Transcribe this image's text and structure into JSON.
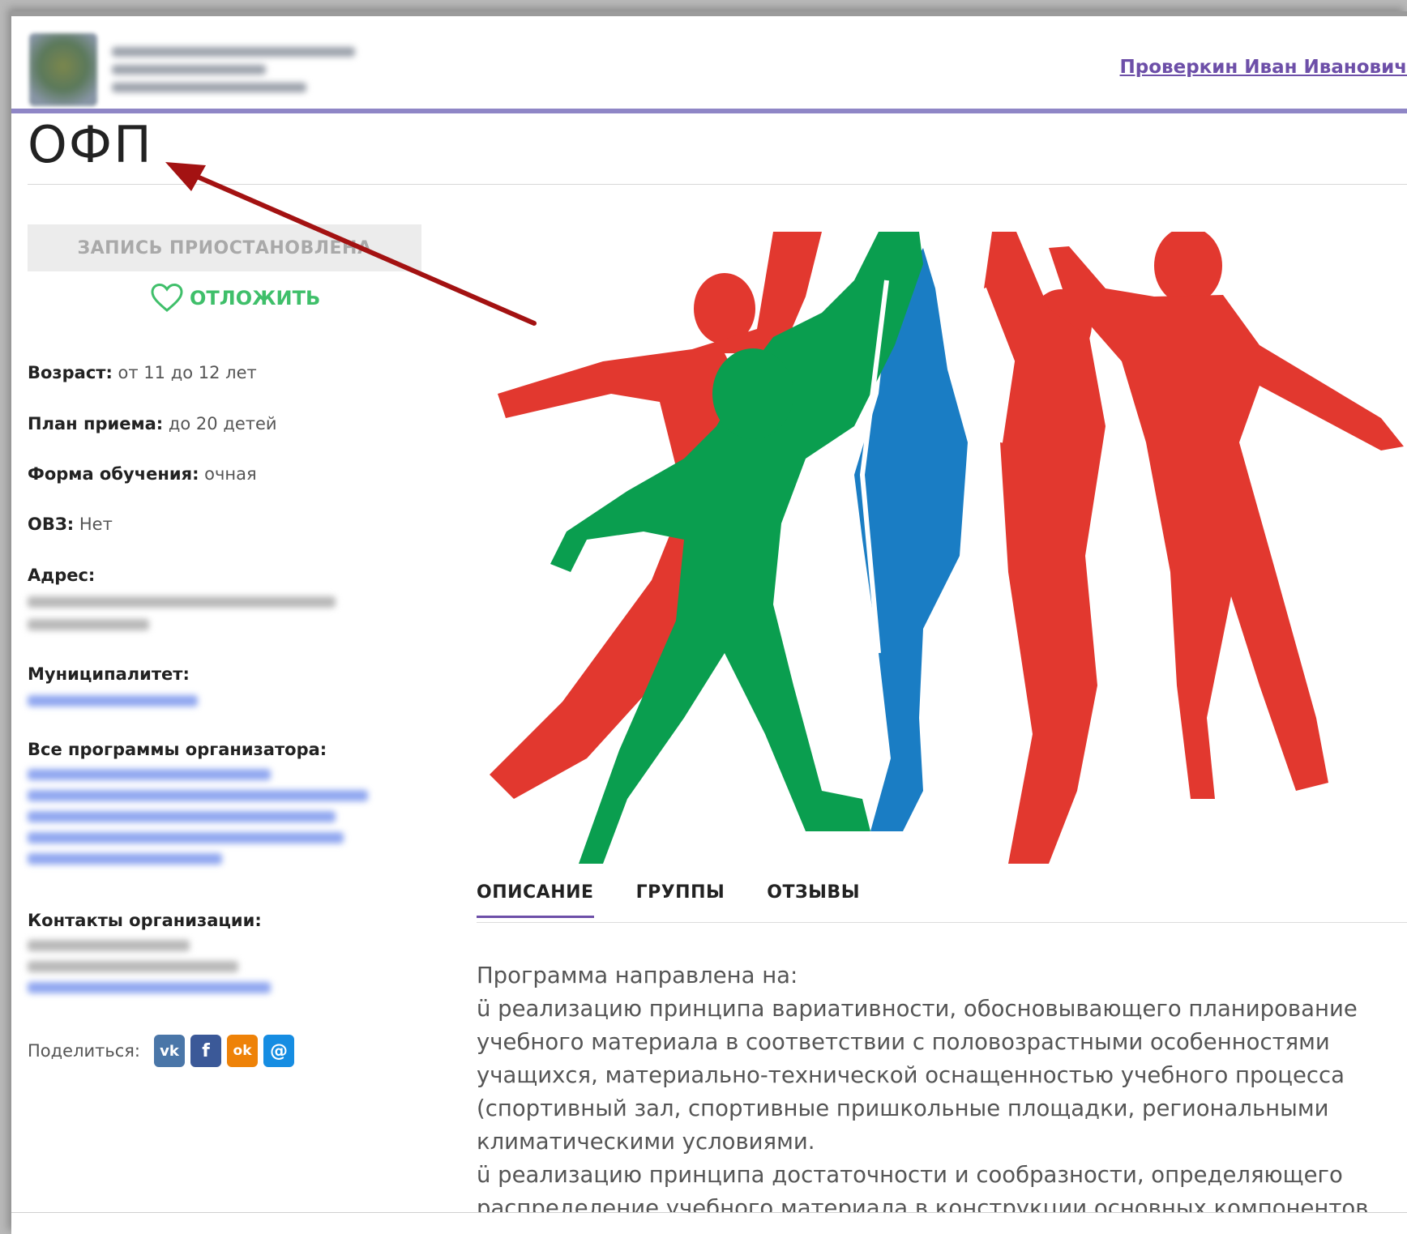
{
  "header": {
    "user_name": "Проверкин Иван Иванович"
  },
  "program": {
    "title": "ОФП",
    "status_button": "ЗАПИСЬ ПРИОСТАНОВЛЕНА",
    "postpone_label": "ОТЛОЖИТЬ"
  },
  "info": {
    "age_label": "Возраст:",
    "age_value": "от 11 до 12 лет",
    "plan_label": "План приема:",
    "plan_value": "до 20 детей",
    "form_label": "Форма обучения:",
    "form_value": "очная",
    "ovz_label": "ОВЗ:",
    "ovz_value": "Нет",
    "address_label": "Адрес:",
    "municipality_label": "Муниципалитет:",
    "all_programs_label": "Все программы организатора:",
    "contacts_label": "Контакты организации:"
  },
  "share": {
    "label": "Поделиться:",
    "buttons": [
      {
        "icon": "vk-icon",
        "glyph": "vk",
        "color": "#4a76a8"
      },
      {
        "icon": "facebook-icon",
        "glyph": "f",
        "color": "#3b5998"
      },
      {
        "icon": "odnoklassniki-icon",
        "glyph": "ok",
        "color": "#ee8208"
      },
      {
        "icon": "mail-ru-icon",
        "glyph": "@",
        "color": "#168de2"
      }
    ]
  },
  "tabs": [
    {
      "label": "ОПИСАНИЕ"
    },
    {
      "label": "ГРУППЫ"
    },
    {
      "label": "ОТЗЫВЫ"
    }
  ],
  "description": {
    "lines": [
      "Программа направлена на:",
      "ü реализацию принципа вариативности, обосновывающего планирование учебного материала в соответствии с половозрастными особенностями учащихся, материально-технической оснащенностью учебного процесса (спортивный зал, спортивные пришкольные площадки, региональными климатическими условиями.",
      "ü реализацию принципа достаточности и сообразности, определяющего распределение учебного материала в конструкции основных компонентов"
    ]
  },
  "colors": {
    "accent": "#6d4fa8",
    "header_line": "#8f86c6",
    "postpone_green": "#3fbf6a",
    "figure_red": "#e2382f",
    "figure_green": "#0a9e4f",
    "figure_blue": "#1a7dc4",
    "arrow": "#a31212"
  }
}
